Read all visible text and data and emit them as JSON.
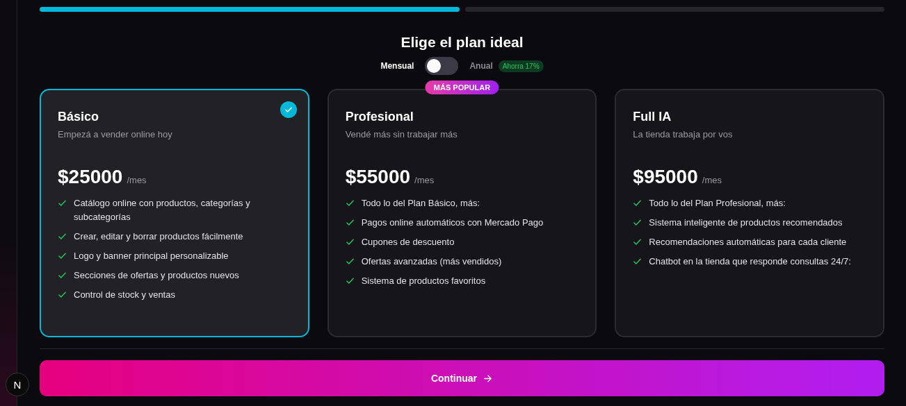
{
  "progress": [
    {
      "done": true
    },
    {
      "done": false
    }
  ],
  "title": "Elige el plan ideal",
  "billing": {
    "monthly_label": "Mensual",
    "annual_label": "Anual",
    "annual": false,
    "savings_badge": "Ahorra 17%"
  },
  "plans": [
    {
      "name": "Básico",
      "tagline": "Empezá a vender online hoy",
      "price": "$25000",
      "period": "/mes",
      "selected": true,
      "features": [
        "Catálogo online con productos, categorías y subcategorías",
        "Crear, editar y borrar productos fácilmente",
        "Logo y banner principal personalizable",
        "Secciones de ofertas y productos nuevos",
        "Control de stock y ventas"
      ]
    },
    {
      "name": "Profesional",
      "tagline": "Vendé más sin trabajar más",
      "price": "$55000",
      "period": "/mes",
      "selected": false,
      "badge": "MÁS POPULAR",
      "features": [
        "Todo lo del Plan Básico, más:",
        "Pagos online automáticos con Mercado Pago",
        "Cupones de descuento",
        "Ofertas avanzadas (más vendidos)",
        "Sistema de productos favoritos"
      ]
    },
    {
      "name": "Full IA",
      "tagline": "La tienda trabaja por vos",
      "price": "$95000",
      "period": "/mes",
      "selected": false,
      "features": [
        "Todo lo del Plan Profesional, más:",
        "Sistema inteligente de productos recomendados",
        "Recomendaciones automáticas para cada cliente",
        "Chatbot en la tienda que responde consultas 24/7:"
      ]
    }
  ],
  "continue_button": "Continuar",
  "dev_badge": "N"
}
